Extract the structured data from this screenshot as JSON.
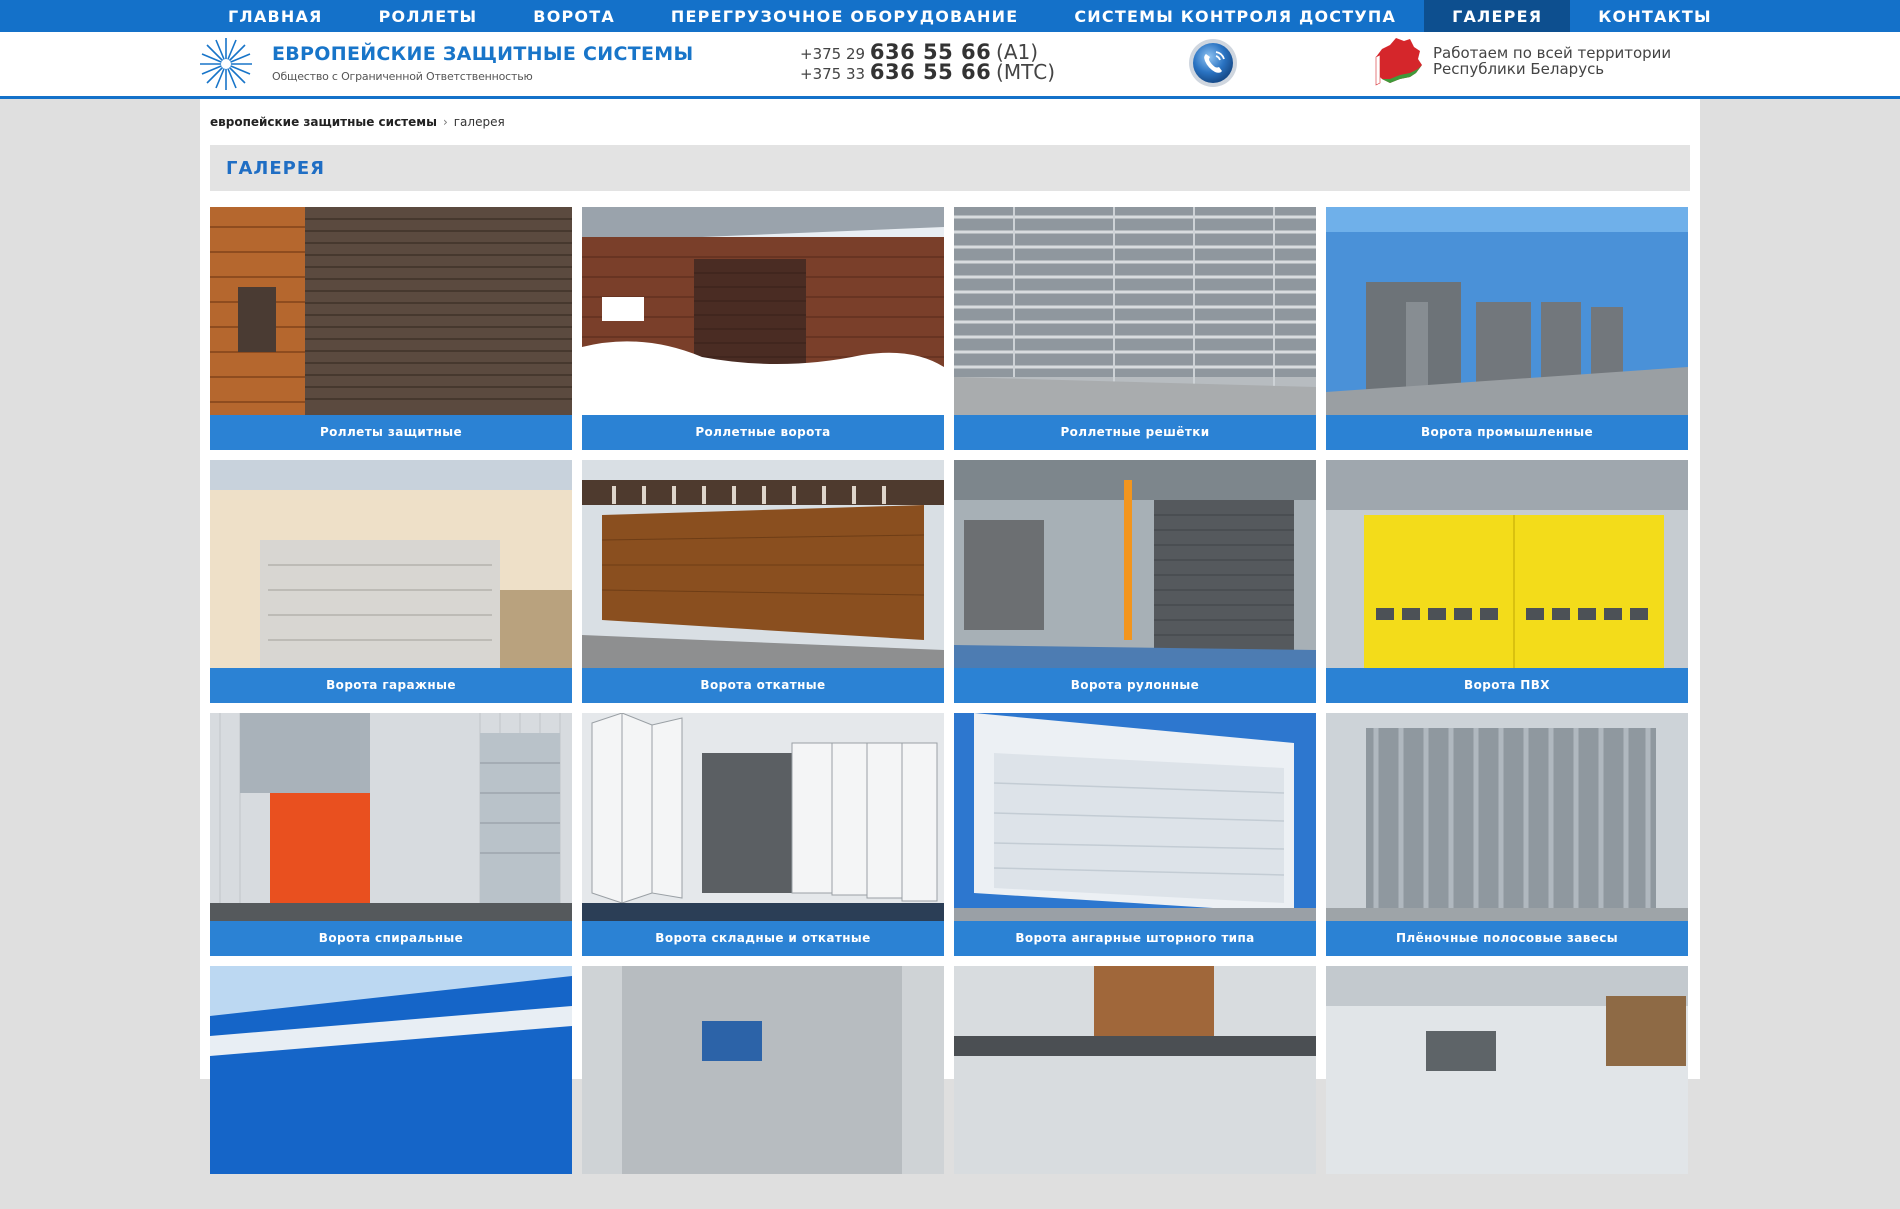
{
  "nav": {
    "items": [
      {
        "label": "ГЛАВНАЯ"
      },
      {
        "label": "РОЛЛЕТЫ"
      },
      {
        "label": "ВОРОТА"
      },
      {
        "label": "ПЕРЕГРУЗОЧНОЕ ОБОРУДОВАНИЕ"
      },
      {
        "label": "СИСТЕМЫ КОНТРОЛЯ ДОСТУПА"
      },
      {
        "label": "ГАЛЕРЕЯ"
      },
      {
        "label": "КОНТАКТЫ"
      }
    ],
    "active": "ГАЛЕРЕЯ"
  },
  "header": {
    "logo_title": "ЕВРОПЕЙСКИЕ ЗАЩИТНЫЕ СИСТЕМЫ",
    "logo_subtitle": "Общество с Ограниченной Ответственностью",
    "phones": [
      {
        "prefix": "+375 29",
        "number": "636 55 66",
        "operator": "(A1)"
      },
      {
        "prefix": "+375 33",
        "number": "636 55 66",
        "operator": "(МТС)"
      }
    ],
    "region_line1": "Работаем по всей территории",
    "region_line2": "Республики Беларусь",
    "phone_icon": "phone-call-icon",
    "map_icon": "belarus-map-icon"
  },
  "breadcrumb": {
    "home": "европейские защитные системы",
    "separator": "›",
    "current": "галерея"
  },
  "page_title": "ГАЛЕРЕЯ",
  "gallery": [
    {
      "caption": "Роллеты защитные"
    },
    {
      "caption": "Роллетные ворота"
    },
    {
      "caption": "Роллетные решётки"
    },
    {
      "caption": "Ворота промышленные"
    },
    {
      "caption": "Ворота гаражные"
    },
    {
      "caption": "Ворота откатные"
    },
    {
      "caption": "Ворота рулонные"
    },
    {
      "caption": "Ворота ПВХ"
    },
    {
      "caption": "Ворота спиральные"
    },
    {
      "caption": "Ворота складные и откатные"
    },
    {
      "caption": "Ворота ангарные шторного типа"
    },
    {
      "caption": "Плёночные полосовые завесы"
    }
  ],
  "colors": {
    "nav_bg": "#1471c9",
    "nav_active": "#0d4f8f",
    "caption_bg": "#2b82d4",
    "title_color": "#1f6ec4"
  }
}
